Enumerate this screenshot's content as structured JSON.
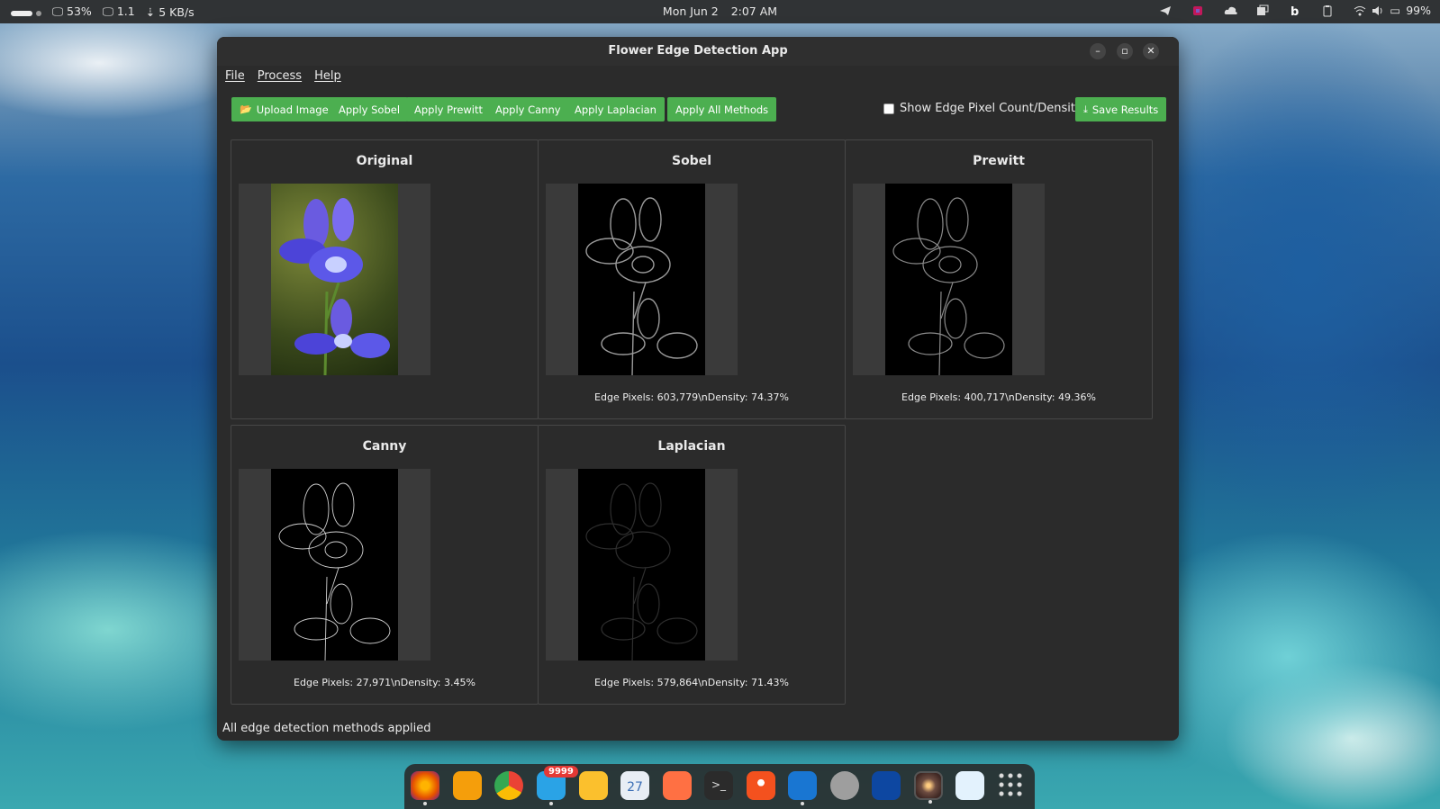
{
  "topbar": {
    "battery_left": "53%",
    "display": "1.1",
    "net": "5 KB/s",
    "date": "Mon Jun 2",
    "time": "2:07 AM",
    "battery_right": "99%"
  },
  "window": {
    "title": "Flower Edge Detection App",
    "menu": [
      "File",
      "Process",
      "Help"
    ],
    "buttons": {
      "upload": "Upload Image",
      "sobel": "Apply Sobel",
      "prewitt": "Apply Prewitt",
      "canny": "Apply Canny",
      "laplacian": "Apply Laplacian",
      "all": "Apply All Methods",
      "save": "Save Results"
    },
    "checkbox_label": "Show Edge Pixel Count/Density",
    "panels": [
      {
        "title": "Original",
        "stat": ""
      },
      {
        "title": "Sobel",
        "stat": "Edge Pixels: 603,779\\nDensity: 74.37%"
      },
      {
        "title": "Prewitt",
        "stat": "Edge Pixels: 400,717\\nDensity: 49.36%"
      },
      {
        "title": "Canny",
        "stat": "Edge Pixels: 27,971\\nDensity: 3.45%"
      },
      {
        "title": "Laplacian",
        "stat": "Edge Pixels: 579,864\\nDensity: 71.43%"
      }
    ],
    "status": "All edge detection methods applied"
  },
  "dock": {
    "badge": "9999",
    "calendar_day": "27"
  },
  "colors": {
    "accent_green": "#4caf50",
    "window_bg": "#2b2b2b"
  }
}
